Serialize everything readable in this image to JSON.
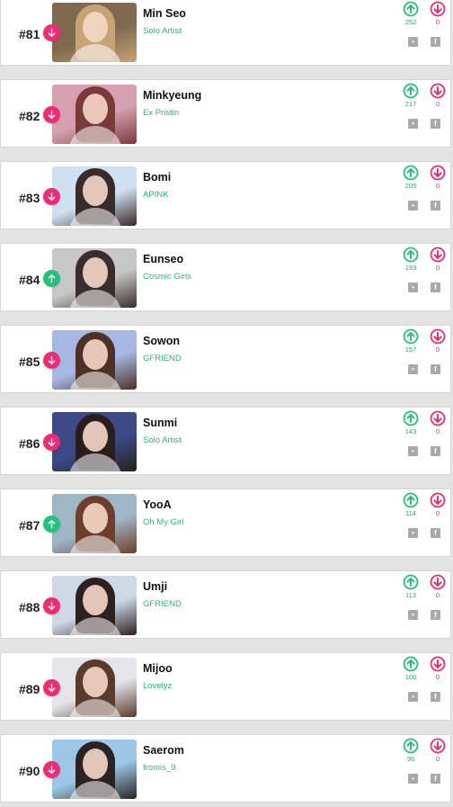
{
  "colors": {
    "up": "#27c07a",
    "down": "#ec2c74",
    "group_text": "#2bb673",
    "share_icons": "#a9a9a9"
  },
  "icons": {
    "trend_down": "arrow-down-icon",
    "trend_up": "arrow-up-icon",
    "upvote": "upvote-circle-icon",
    "downvote": "downvote-circle-icon",
    "twitter": "twitter-icon",
    "facebook": "facebook-icon"
  },
  "rankings": [
    {
      "rank": "#81",
      "name": "Min Seo",
      "group": "Solo Artist",
      "trend": "down",
      "up_votes": "252",
      "down_votes": "0",
      "photo_colors": [
        "#7f6a4f",
        "#c7a476"
      ]
    },
    {
      "rank": "#82",
      "name": "Minkyeung",
      "group": "Ex Pristin",
      "trend": "down",
      "up_votes": "217",
      "down_votes": "0",
      "photo_colors": [
        "#d7a0b0",
        "#7a3a3a"
      ]
    },
    {
      "rank": "#83",
      "name": "Bomi",
      "group": "APINK",
      "trend": "down",
      "up_votes": "205",
      "down_votes": "0",
      "photo_colors": [
        "#cfe0f2",
        "#3a2a2a"
      ]
    },
    {
      "rank": "#84",
      "name": "Eunseo",
      "group": "Cosmic Girls",
      "trend": "up",
      "up_votes": "193",
      "down_votes": "0",
      "photo_colors": [
        "#c7c7c7",
        "#3b2d2d"
      ]
    },
    {
      "rank": "#85",
      "name": "Sowon",
      "group": "GFRIEND",
      "trend": "down",
      "up_votes": "157",
      "down_votes": "0",
      "photo_colors": [
        "#a7b7e4",
        "#4d3126"
      ]
    },
    {
      "rank": "#86",
      "name": "Sunmi",
      "group": "Solo Artist",
      "trend": "down",
      "up_votes": "143",
      "down_votes": "0",
      "photo_colors": [
        "#3c4b88",
        "#2a1d1d"
      ]
    },
    {
      "rank": "#87",
      "name": "YooA",
      "group": "Oh My Girl",
      "trend": "up",
      "up_votes": "114",
      "down_votes": "0",
      "photo_colors": [
        "#9fb6c7",
        "#6d3e2a"
      ]
    },
    {
      "rank": "#88",
      "name": "Umji",
      "group": "GFRIEND",
      "trend": "down",
      "up_votes": "113",
      "down_votes": "0",
      "photo_colors": [
        "#cfd9e6",
        "#2c2020"
      ]
    },
    {
      "rank": "#89",
      "name": "Mijoo",
      "group": "Lovelyz",
      "trend": "down",
      "up_votes": "106",
      "down_votes": "0",
      "photo_colors": [
        "#e4e4ea",
        "#5a3a2a"
      ]
    },
    {
      "rank": "#90",
      "name": "Saerom",
      "group": "fromis_9",
      "trend": "down",
      "up_votes": "96",
      "down_votes": "0",
      "photo_colors": [
        "#9cc7e6",
        "#2b2222"
      ]
    }
  ]
}
